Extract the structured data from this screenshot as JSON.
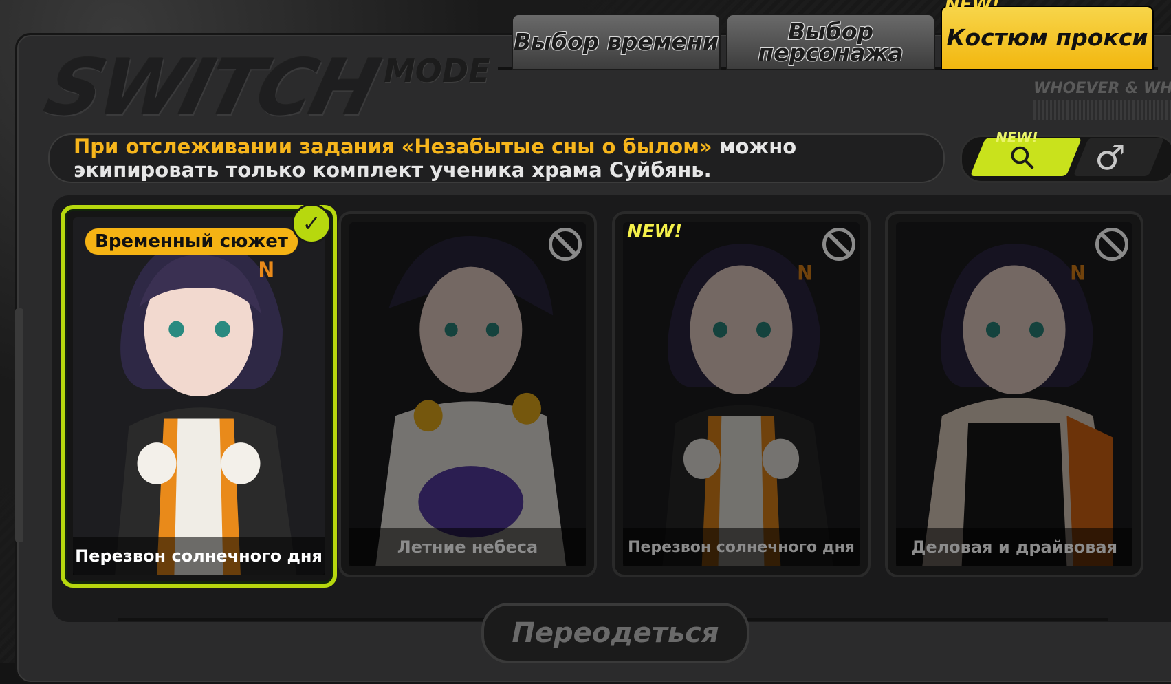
{
  "header": {
    "logo": "SWITCH",
    "logo_mode": "MODE",
    "corner_text": "WHOEVER & WHENEVER"
  },
  "tabs": [
    {
      "label": "Выбор времени",
      "active": false
    },
    {
      "label": "Выбор персонажа",
      "active": false
    },
    {
      "label": "Костюм прокси",
      "active": true
    }
  ],
  "tab_new_badge": "NEW!",
  "notice": {
    "highlight": "При отслеживании задания «Незабытые сны о былом»",
    "rest": " можно экипировать только комплект ученика храма Суйбянь."
  },
  "gender_toggle": {
    "female_symbol": "⚲",
    "male_symbol": "♂",
    "new_badge": "NEW!",
    "selected": "female"
  },
  "outfits": [
    {
      "name": "Перезвон солнечного дня",
      "selected": true,
      "locked": false,
      "badge": "Временный сюжет"
    },
    {
      "name": "Летние небеса",
      "selected": false,
      "locked": true
    },
    {
      "name": "Перезвон солнечного дня",
      "selected": false,
      "locked": true,
      "new_badge": "NEW!"
    },
    {
      "name": "Деловая и драйвовая",
      "selected": false,
      "locked": true
    }
  ],
  "wear_button": "Переодеться",
  "colors": {
    "accent_yellow": "#f2b70f",
    "accent_green": "#b7d80e",
    "orange": "#f6b51c"
  }
}
